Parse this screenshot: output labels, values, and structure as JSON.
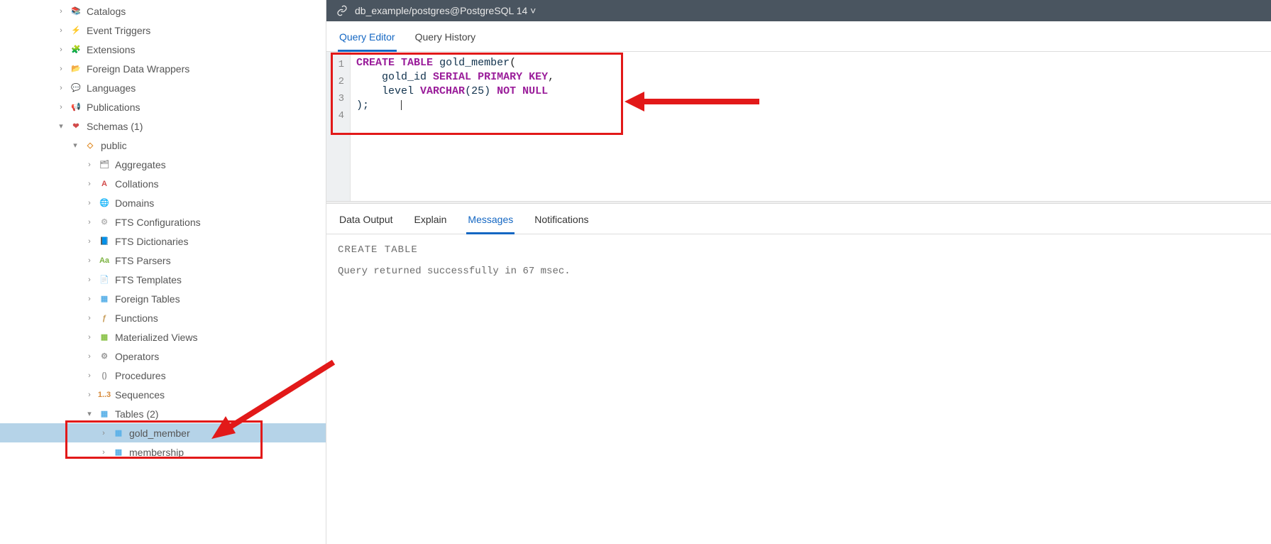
{
  "sidebar": {
    "items": [
      {
        "indent": 0,
        "chev": ">",
        "icon": "📚",
        "color": "#d19b2f",
        "label": "Catalogs"
      },
      {
        "indent": 0,
        "chev": ">",
        "icon": "⚡",
        "color": "#4aa3df",
        "label": "Event Triggers"
      },
      {
        "indent": 0,
        "chev": ">",
        "icon": "🧩",
        "color": "#7cb342",
        "label": "Extensions"
      },
      {
        "indent": 0,
        "chev": ">",
        "icon": "📂",
        "color": "#d6a24e",
        "label": "Foreign Data Wrappers"
      },
      {
        "indent": 0,
        "chev": ">",
        "icon": "💬",
        "color": "#e3b74c",
        "label": "Languages"
      },
      {
        "indent": 0,
        "chev": ">",
        "icon": "📢",
        "color": "#9a9a9a",
        "label": "Publications"
      },
      {
        "indent": 0,
        "chev": "v",
        "icon": "❤",
        "color": "#d24b4b",
        "label": "Schemas (1)"
      },
      {
        "indent": 1,
        "chev": "v",
        "icon": "◇",
        "color": "#e08a24",
        "label": "public"
      },
      {
        "indent": 2,
        "chev": ">",
        "icon": "🗂",
        "color": "#9a9a9a",
        "label": "Aggregates"
      },
      {
        "indent": 2,
        "chev": ">",
        "icon": "A",
        "color": "#d24b4b",
        "label": "Collations"
      },
      {
        "indent": 2,
        "chev": ">",
        "icon": "🌐",
        "color": "#9a9a9a",
        "label": "Domains"
      },
      {
        "indent": 2,
        "chev": ">",
        "icon": "⚙",
        "color": "#b7b7b7",
        "label": "FTS Configurations"
      },
      {
        "indent": 2,
        "chev": ">",
        "icon": "📘",
        "color": "#4a8bd6",
        "label": "FTS Dictionaries"
      },
      {
        "indent": 2,
        "chev": ">",
        "icon": "Aa",
        "color": "#7cb342",
        "label": "FTS Parsers"
      },
      {
        "indent": 2,
        "chev": ">",
        "icon": "📄",
        "color": "#e3b74c",
        "label": "FTS Templates"
      },
      {
        "indent": 2,
        "chev": ">",
        "icon": "▦",
        "color": "#5bb1e8",
        "label": "Foreign Tables"
      },
      {
        "indent": 2,
        "chev": ">",
        "icon": "ƒ",
        "color": "#c79b56",
        "label": "Functions"
      },
      {
        "indent": 2,
        "chev": ">",
        "icon": "▦",
        "color": "#8bc34a",
        "label": "Materialized Views"
      },
      {
        "indent": 2,
        "chev": ">",
        "icon": "⚙",
        "color": "#9a9a9a",
        "label": "Operators"
      },
      {
        "indent": 2,
        "chev": ">",
        "icon": "()",
        "color": "#9a9a9a",
        "label": "Procedures"
      },
      {
        "indent": 2,
        "chev": ">",
        "icon": "1..3",
        "color": "#d68a3b",
        "label": "Sequences"
      },
      {
        "indent": 2,
        "chev": "v",
        "icon": "▦",
        "color": "#5bb1e8",
        "label": "Tables (2)"
      },
      {
        "indent": 3,
        "chev": ">",
        "icon": "▦",
        "color": "#5bb1e8",
        "label": "gold_member",
        "selected": true
      },
      {
        "indent": 3,
        "chev": ">",
        "icon": "▦",
        "color": "#5bb1e8",
        "label": "membership"
      }
    ]
  },
  "pathbar": {
    "text": "db_example/postgres@PostgreSQL 14 ˅"
  },
  "editor_tabs": {
    "query_editor": "Query Editor",
    "query_history": "Query History",
    "active": "query_editor"
  },
  "editor": {
    "lines": [
      "1",
      "2",
      "3",
      "4"
    ],
    "l1_kw1": "CREATE",
    "l1_kw2": "TABLE",
    "l1_name": "gold_member",
    "l1_tail": "(",
    "l2_col": "gold_id",
    "l2_t1": "SERIAL",
    "l2_kw": "PRIMARY KEY",
    "l2_tail": ",",
    "l3_col": "level",
    "l3_t": "VARCHAR",
    "l3_args": "(25)",
    "l3_kw": "NOT NULL",
    "l4": ");"
  },
  "output_tabs": {
    "data_output": "Data Output",
    "explain": "Explain",
    "messages": "Messages",
    "notifications": "Notifications",
    "active": "messages"
  },
  "messages": {
    "header": "CREATE TABLE",
    "body": "Query returned successfully in 67 msec."
  }
}
